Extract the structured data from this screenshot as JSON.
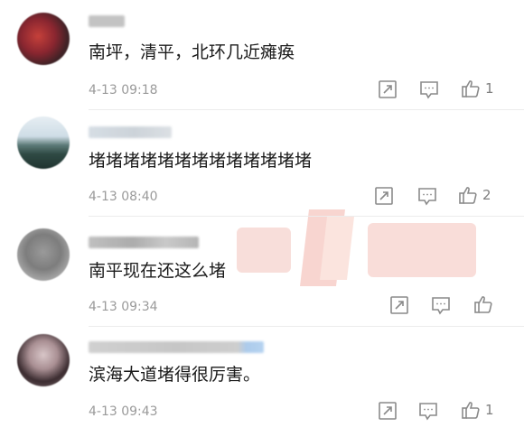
{
  "comments": [
    {
      "text": "南坪，清平，北环几近瘫痪",
      "time": "4-13 09:18",
      "like_count": "1"
    },
    {
      "text": "堵堵堵堵堵堵堵堵堵堵堵堵堵",
      "time": "4-13 08:40",
      "like_count": "2"
    },
    {
      "text": "南平现在还这么堵",
      "time": "4-13 09:34",
      "like_count": ""
    },
    {
      "text": "滨海大道堵得很厉害。",
      "time": "4-13 09:43",
      "like_count": "1"
    }
  ],
  "icons": {
    "share": "share-icon",
    "reply": "reply-icon",
    "like": "thumbs-up-icon"
  },
  "colors": {
    "text": "#1a1a1a",
    "meta": "#9a9a9a",
    "icon": "#8a8a8a",
    "watermark": "#e0432e"
  }
}
